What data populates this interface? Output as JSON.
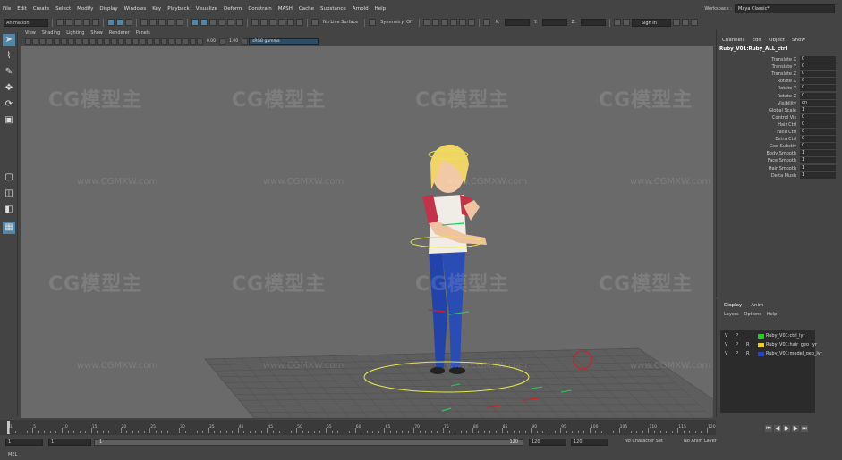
{
  "menubar": {
    "items": [
      "File",
      "Edit",
      "Create",
      "Select",
      "Modify",
      "Display",
      "Windows",
      "Key",
      "Playback",
      "Visualize",
      "Deform",
      "Constrain",
      "MASH",
      "Cache",
      "Substance",
      "Arnold",
      "Help"
    ]
  },
  "workspace": {
    "label": "Workspace :",
    "value": "Maya Classic*"
  },
  "statusline": {
    "mode": "Animation",
    "surface": "No Live Surface",
    "symmetry": "Symmetry: Off",
    "x_label": "X:",
    "y_label": "Y:",
    "z_label": "Z:",
    "signin": "Sign In"
  },
  "viewport": {
    "menu": [
      "View",
      "Shading",
      "Lighting",
      "Show",
      "Renderer",
      "Panels"
    ],
    "near": "0.00",
    "far": "1.00",
    "colorspace": "sRGB gamma",
    "watermark_text": "CG模型主",
    "watermark_url": "www.CGMXW.com"
  },
  "channelbox": {
    "menu": [
      "Channels",
      "Edit",
      "Object",
      "Show"
    ],
    "object": "Ruby_V01:Ruby_ALL_ctrl",
    "attributes": [
      {
        "name": "Translate X",
        "value": "0"
      },
      {
        "name": "Translate Y",
        "value": "0"
      },
      {
        "name": "Translate Z",
        "value": "0"
      },
      {
        "name": "Rotate X",
        "value": "0"
      },
      {
        "name": "Rotate Y",
        "value": "0"
      },
      {
        "name": "Rotate Z",
        "value": "0"
      },
      {
        "name": "Visibility",
        "value": "on"
      },
      {
        "name": "Global Scale",
        "value": "1"
      },
      {
        "name": "Control Vis",
        "value": "0"
      },
      {
        "name": "Hair Ctrl",
        "value": "0"
      },
      {
        "name": "Face Ctrl",
        "value": "0"
      },
      {
        "name": "Extra Ctrl",
        "value": "0"
      },
      {
        "name": "Geo Substiv",
        "value": "0"
      },
      {
        "name": "Body Smooth",
        "value": "1"
      },
      {
        "name": "Face Smooth",
        "value": "1"
      },
      {
        "name": "Hair Smooth",
        "value": "1"
      },
      {
        "name": "Delta Mush",
        "value": "1"
      }
    ]
  },
  "layerbox": {
    "tabs": [
      "Display",
      "Anim"
    ],
    "menu": [
      "Layers",
      "Options",
      "Help"
    ],
    "layers": [
      {
        "v": "V",
        "p": "P",
        "r": "",
        "name": "Ruby_V01:ctrl_lyr",
        "color": "#22cc22"
      },
      {
        "v": "V",
        "p": "P",
        "r": "R",
        "name": "Ruby_V01:hair_geo_lyr",
        "color": "#eecc22"
      },
      {
        "v": "V",
        "p": "P",
        "r": "R",
        "name": "Ruby_V01:model_geo_lyr",
        "color": "#2244cc"
      }
    ]
  },
  "timeslider": {
    "ticks": [
      "1",
      "5",
      "10",
      "15",
      "20",
      "25",
      "30",
      "35",
      "40",
      "45",
      "50",
      "55",
      "60",
      "65",
      "70",
      "75",
      "80",
      "85",
      "90",
      "95",
      "100",
      "105",
      "110",
      "115",
      "120"
    ],
    "current": "1"
  },
  "range": {
    "start": "1",
    "start_inner": "1",
    "slider_start": "1",
    "slider_end": "120",
    "end_inner": "120",
    "end": "120",
    "char_set": "No Character Set",
    "anim_layer": "No Anim Layer"
  },
  "mel": {
    "label": "MEL"
  }
}
